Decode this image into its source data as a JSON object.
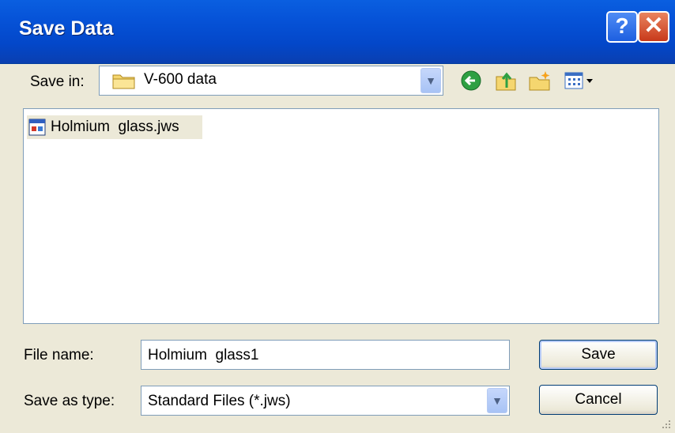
{
  "window": {
    "title": "Save Data",
    "help_label": "?",
    "close_label": "✕"
  },
  "save_in": {
    "label": "Save in:",
    "value": "V-600 data"
  },
  "toolbar": {
    "icons": [
      "back-icon",
      "up-folder-icon",
      "new-folder-icon",
      "views-menu-icon"
    ]
  },
  "files": [
    {
      "name": "Holmium  glass.jws",
      "icon": "jws-file-icon"
    }
  ],
  "file_name": {
    "label": "File name:",
    "value": "Holmium  glass1"
  },
  "save_as_type": {
    "label": "Save as type:",
    "value": "Standard Files (*.jws)"
  },
  "buttons": {
    "save": "Save",
    "cancel": "Cancel"
  },
  "colors": {
    "titlebar": "#0653d8",
    "dialog_bg": "#ece9d8",
    "field_border": "#7f9db9"
  }
}
